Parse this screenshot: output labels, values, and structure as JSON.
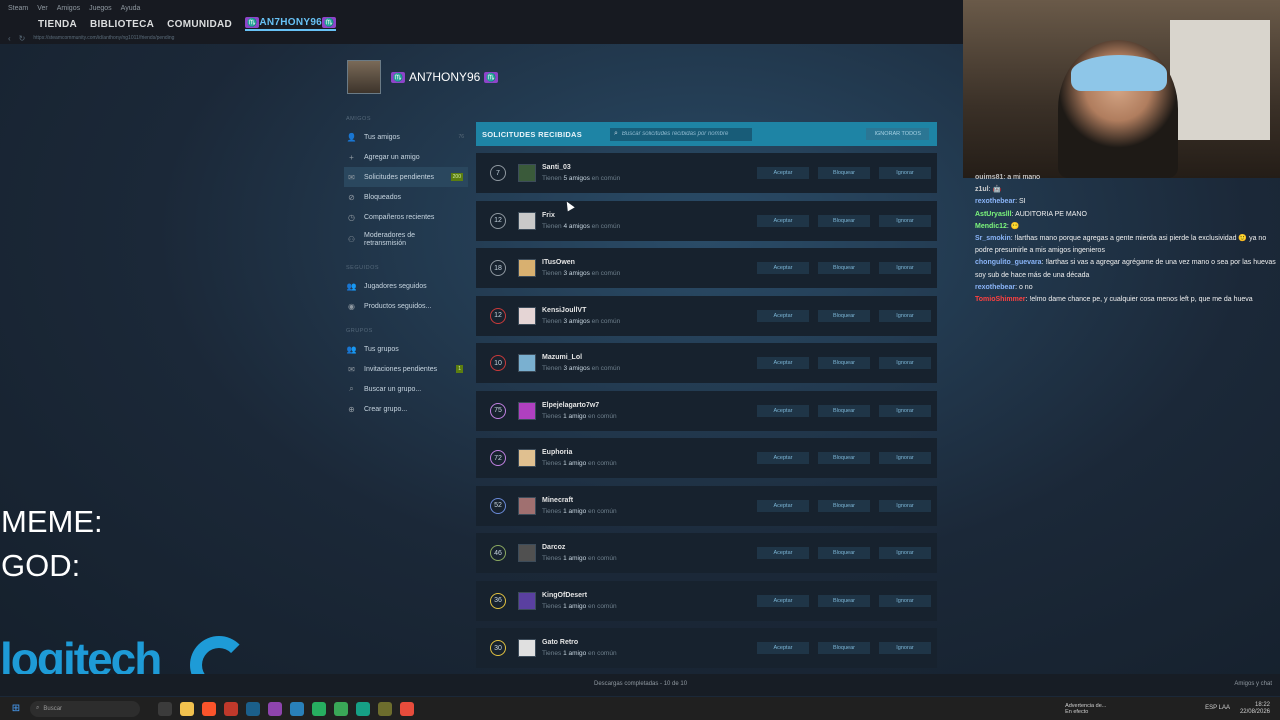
{
  "menubar": [
    "Steam",
    "Ver",
    "Amigos",
    "Juegos",
    "Ayuda"
  ],
  "nav": {
    "items": [
      "TIENDA",
      "BIBLIOTECA",
      "COMUNIDAD"
    ],
    "active": "AN7HONY96",
    "zodiac": "♏"
  },
  "url": "https://steamcommunity.com/id/anthony/ng1011/friends/pending",
  "profile": {
    "name": "AN7HONY96",
    "zodiac": "♏"
  },
  "sidebar": {
    "friends_title": "AMIGOS",
    "friends": [
      {
        "label": "Tus amigos",
        "icon": "person-icon",
        "count": "76"
      },
      {
        "label": "Agregar un amigo",
        "icon": "add-person-icon"
      },
      {
        "label": "Solicitudes pendientes",
        "icon": "mail-icon",
        "badge": "200"
      },
      {
        "label": "Bloqueados",
        "icon": "blocked-icon"
      },
      {
        "label": "Compañeros recientes",
        "icon": "clock-icon"
      },
      {
        "label": "Moderadores de retransmisión",
        "icon": "moderator-icon"
      }
    ],
    "following_title": "SEGUIDOS",
    "following": [
      {
        "label": "Jugadores seguidos",
        "icon": "players-icon"
      },
      {
        "label": "Productos seguidos...",
        "icon": "eye-icon"
      }
    ],
    "groups_title": "GRUPOS",
    "groups": [
      {
        "label": "Tus grupos",
        "icon": "group-icon"
      },
      {
        "label": "Invitaciones pendientes",
        "icon": "mail-icon",
        "badge": "1"
      },
      {
        "label": "Buscar un grupo...",
        "icon": "search-icon"
      },
      {
        "label": "Crear grupo...",
        "icon": "plus-circle-icon"
      }
    ]
  },
  "list": {
    "title": "SOLICITUDES RECIBIDAS",
    "search_placeholder": "Buscar solicitudes recibidas por nombre",
    "ignore_all": "IGNORAR TODOS",
    "accept": "Aceptar",
    "block": "Bloquear",
    "ignore": "Ignorar",
    "rows": [
      {
        "level": "7",
        "name": "Santi_03",
        "pre": "Tienen",
        "count": "5 amigos",
        "post": "en común",
        "color": "#8f98a0",
        "avatar": "#3a5a3a"
      },
      {
        "level": "12",
        "name": "Frix",
        "pre": "Tienen",
        "count": "4 amigos",
        "post": "en común",
        "color": "#8f98a0",
        "avatar": "#c9c9c9"
      },
      {
        "level": "18",
        "name": "ITusOwen",
        "pre": "Tienen",
        "count": "3 amigos",
        "post": "en común",
        "color": "#8f98a0",
        "avatar": "#d8b070"
      },
      {
        "level": "12",
        "name": "KensiJoullVT",
        "pre": "Tienen",
        "count": "3 amigos",
        "post": "en común",
        "color": "#c93a3a",
        "avatar": "#e5d5d5"
      },
      {
        "level": "10",
        "name": "Mazumi_Lol",
        "pre": "Tienen",
        "count": "3 amigos",
        "post": "en común",
        "color": "#c93a3a",
        "avatar": "#7ab0d0"
      },
      {
        "level": "75",
        "name": "Elpejelagarto7w7",
        "pre": "Tienes",
        "count": "1 amigo",
        "post": "en común",
        "color": "#c080e0",
        "avatar": "#b040c0"
      },
      {
        "level": "72",
        "name": "Euphoria",
        "pre": "Tienes",
        "count": "1 amigo",
        "post": "en común",
        "color": "#c080e0",
        "avatar": "#e0c090"
      },
      {
        "level": "52",
        "name": "Minecraft",
        "pre": "Tienes",
        "count": "1 amigo",
        "post": "en común",
        "color": "#6a8ad8",
        "avatar": "#a07070"
      },
      {
        "level": "46",
        "name": "Darcoz",
        "pre": "Tienes",
        "count": "1 amigo",
        "post": "en común",
        "color": "#8aa860",
        "avatar": "#505050"
      },
      {
        "level": "36",
        "name": "KingOfDesert",
        "pre": "Tienes",
        "count": "1 amigo",
        "post": "en común",
        "color": "#e0c040",
        "avatar": "#5a40a0"
      },
      {
        "level": "30",
        "name": "Gato Retro",
        "pre": "Tienes",
        "count": "1 amigo",
        "post": "en común",
        "color": "#e0c040",
        "avatar": "#e0e0e0"
      }
    ]
  },
  "chat": [
    {
      "user": "ouims81",
      "text": ": a mi mano",
      "class": "u-gray"
    },
    {
      "user": "z1ul",
      "text": ": 🤖",
      "class": "u-yellowish"
    },
    {
      "user": "rexothebear",
      "text": ": SI",
      "class": "u-blue"
    },
    {
      "user": "AstUryaslll",
      "text": ": AUDITORIA PE MANO",
      "class": "u-green"
    },
    {
      "user": "Mendic12",
      "text": ": 😶",
      "class": "u-green"
    },
    {
      "user": "Sr_smokin",
      "text": ": !larthas mano porque agregas a gente mierda asi pierde la exclusividad 🙂 ya no podre presumirle a mis amigos ingenieros",
      "class": "u-blue"
    },
    {
      "user": "chongulito_guevara",
      "text": ": !larthas si vas a agregar agrégame de una vez mano o sea por las huevas soy sub de hace más de una década",
      "class": "u-blue"
    },
    {
      "user": "rexothebear",
      "text": ": o no",
      "class": "u-blue"
    },
    {
      "user": "TomioShimmer",
      "text": ": !elmo dame chance pe, y cualquier cosa menos left p, que me da hueva",
      "class": "u-red"
    }
  ],
  "overlay": {
    "meme": "MEME:",
    "god": "GOD:",
    "brand": "logitech"
  },
  "statusbar": {
    "downloads": "Descargas completadas - 10 de 10",
    "friends": "Amigos y chat"
  },
  "taskbar": {
    "search": "Buscar",
    "notice_title": "Advertencia de...",
    "notice_sub": "En efecto",
    "lang": "ESP LAA",
    "time": "18:22",
    "date": "22/08/2026"
  }
}
